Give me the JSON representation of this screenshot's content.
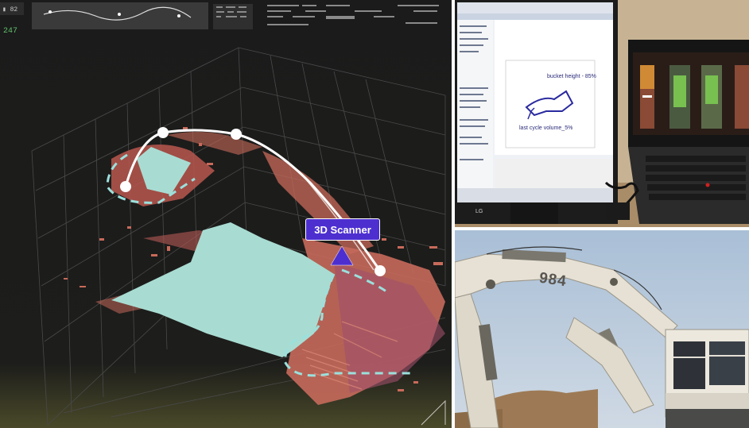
{
  "left_panel": {
    "hud_value": "247",
    "scanner_label": "3D Scanner"
  },
  "top_right_panel": {
    "plot_title": "bucket height - 85%",
    "plot_caption": "last cycle volume_5%",
    "monitor_brand": "LG"
  },
  "bottom_right_panel": {
    "machine_number": "984"
  },
  "colors": {
    "point_cloud": "#c86a5a",
    "bucket_fill": "#a8dcd2",
    "trajectory": "#ffffff",
    "tag_bg": "#4d2fd0",
    "dashed_outline": "#9be0dc"
  }
}
